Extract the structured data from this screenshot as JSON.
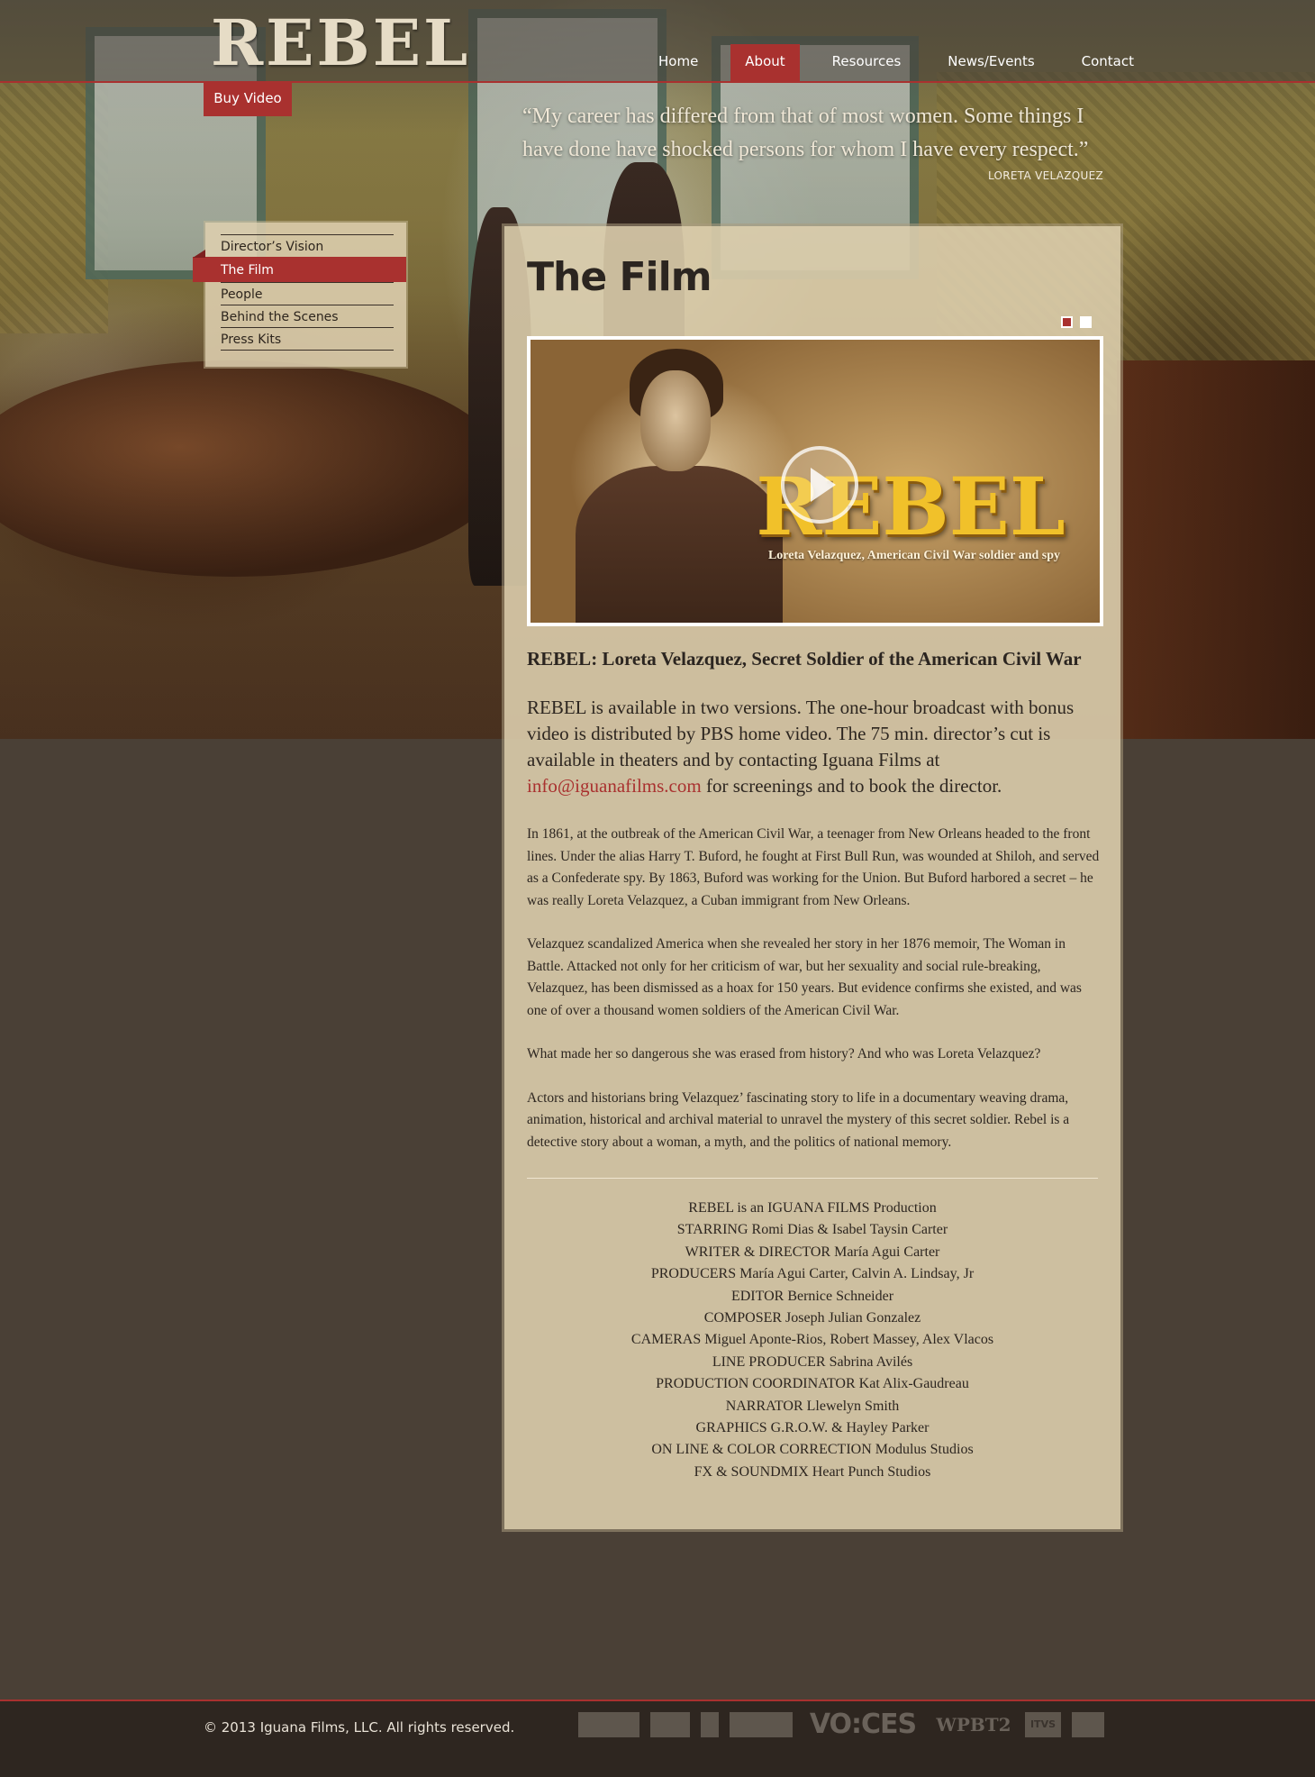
{
  "site": {
    "logo": "REBEL",
    "buy_label": "Buy Video"
  },
  "nav": {
    "items": [
      {
        "label": "Home",
        "active": false
      },
      {
        "label": "About",
        "active": true
      },
      {
        "label": "Resources",
        "active": false
      },
      {
        "label": "News/Events",
        "active": false
      },
      {
        "label": "Contact",
        "active": false
      }
    ]
  },
  "quote": {
    "text": "“My career has differed from that of most women.  Some things I have done have shocked persons for whom I have every respect.”",
    "author": "LORETA VELAZQUEZ"
  },
  "subnav": {
    "items": [
      {
        "label": "Director’s Vision",
        "active": false
      },
      {
        "label": "The Film",
        "active": true
      },
      {
        "label": "People",
        "active": false
      },
      {
        "label": "Behind the Scenes",
        "active": false
      },
      {
        "label": "Press Kits",
        "active": false
      }
    ]
  },
  "content": {
    "title": "The Film",
    "slider_dots": [
      true,
      false
    ],
    "video": {
      "title": "REBEL",
      "subtitle": "Loreta Velazquez, American Civil War soldier and spy"
    },
    "subtitle": "REBEL: Loreta Velazquez, Secret Soldier of the American Civil War",
    "lead_before": "REBEL is available in two versions. The one-hour broadcast with bonus video is distributed by PBS home video. The 75 min. director’s cut is available in theaters and by contacting Iguana Films at ",
    "lead_link": "info@iguanafilms.com",
    "lead_after": " for screenings and to book the director.",
    "paragraphs": [
      "In 1861, at the outbreak of the American Civil War, a teenager from New Orleans headed to the front lines. Under the alias Harry T. Buford, he fought at First Bull Run, was wounded at Shiloh, and served as a Confederate spy. By 1863, Buford was working for the Union. But Buford harbored a secret – he was really Loreta Velazquez, a Cuban immigrant from New Orleans.",
      "Velazquez scandalized America when she revealed her story in her 1876 memoir, The Woman in Battle. Attacked not only for her criticism of war, but her sexuality and social rule-breaking, Velazquez, has been dismissed as a hoax for 150 years. But evidence confirms she existed, and was one of over a thousand women soldiers of the American Civil War.",
      "What made her so dangerous she was erased from history? And who was Loreta Velazquez?",
      "Actors and historians bring Velazquez’ fascinating story to life in a documentary weaving drama, animation, historical and archival material to unravel the mystery of this secret soldier. Rebel is a detective story about a woman, a myth, and the politics of national memory."
    ],
    "credits": [
      "REBEL is an IGUANA FILMS Production",
      "STARRING Romi Dias & Isabel Taysin Carter",
      "WRITER & DIRECTOR María Agui Carter",
      "PRODUCERS María Agui Carter, Calvin A. Lindsay, Jr",
      "EDITOR Bernice Schneider",
      "COMPOSER Joseph Julian Gonzalez",
      "CAMERAS Miguel Aponte-Rios, Robert Massey, Alex Vlacos",
      "LINE PRODUCER Sabrina Avilés",
      "PRODUCTION COORDINATOR Kat Alix-Gaudreau",
      "NARRATOR Llewelyn Smith",
      "GRAPHICS G.R.O.W. & Hayley Parker",
      "ON LINE & COLOR CORRECTION Modulus Studios",
      "FX & SOUNDMIX Heart Punch Studios"
    ]
  },
  "footer": {
    "copyright": "© 2013 Iguana Films, LLC. All rights reserved.",
    "partner_logos": [
      "partner-logo",
      "latino-logo",
      "seal-logo",
      "partner-logo",
      "partner-logo",
      "voces",
      "wpbt2",
      "itvs",
      "partner-logo"
    ],
    "voces_text": "VO:CES",
    "wpbt_text": "WPBT2",
    "itvs_text": "ITVS"
  },
  "colors": {
    "accent": "#a9312f",
    "page_bg": "#4a4036",
    "panel_bg": "#dccdac",
    "footer_bg": "#2e2620"
  }
}
